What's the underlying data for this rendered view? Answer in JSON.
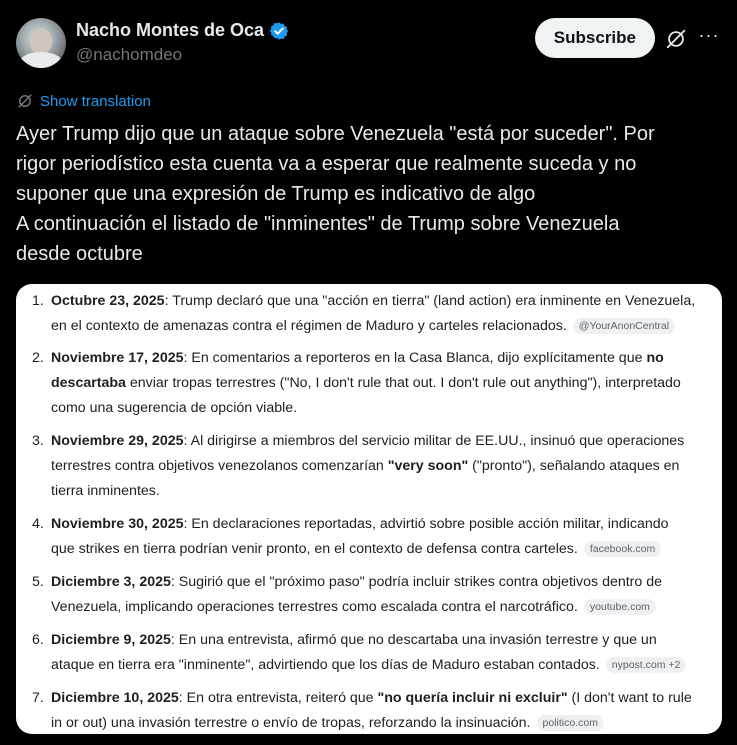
{
  "header": {
    "display_name": "Nacho Montes de Oca",
    "handle": "@nachomdeo",
    "subscribe_label": "Subscribe",
    "more_label": "···"
  },
  "translate": {
    "label": "Show translation"
  },
  "tweet": {
    "lines": [
      "Ayer Trump dijo que un ataque sobre Venezuela \"está por suceder\". Por",
      "rigor periodístico esta cuenta va a esperar que realmente suceda y no",
      "suponer que una expresión de Trump es indicativo de algo",
      "A continuación el listado de \"inminentes\" de Trump sobre Venezuela",
      "desde octubre"
    ]
  },
  "list": [
    {
      "num": "1.",
      "date": "Octubre 23, 2025",
      "text_a": ": Trump declaró que una \"acción en tierra\" (land action) era inminente en Venezuela,",
      "text_b": "en el contexto de amenazas contra el régimen de Maduro y carteles relacionados.",
      "source": "@YourAnonCentral"
    },
    {
      "num": "2.",
      "date": "Noviembre 17, 2025",
      "text_a": ": En comentarios a reporteros en la Casa Blanca, dijo explícitamente que ",
      "bold_1": "no",
      "bold_2": "descartaba",
      "text_b": " enviar tropas terrestres (\"No, I don't rule that out. I don't rule out anything\"), interpretado",
      "text_c": "como una sugerencia de opción viable."
    },
    {
      "num": "3.",
      "date": "Noviembre 29, 2025",
      "text_a": ": Al dirigirse a miembros del servicio militar de EE.UU., insinuó que operaciones",
      "text_b": "terrestres contra objetivos venezolanos comenzarían ",
      "bold_1": "\"very soon\"",
      "text_c": " (\"pronto\"), señalando ataques en",
      "text_d": "tierra inminentes."
    },
    {
      "num": "4.",
      "date": "Noviembre 30, 2025",
      "text_a": ": En declaraciones reportadas, advirtió sobre posible acción militar, indicando",
      "text_b": "que strikes en tierra podrían venir pronto, en el contexto de defensa contra carteles.",
      "source": "facebook.com"
    },
    {
      "num": "5.",
      "date": "Diciembre 3, 2025",
      "text_a": ": Sugirió que el \"próximo paso\" podría incluir strikes contra objetivos dentro de",
      "text_b": "Venezuela, implicando operaciones terrestres como escalada contra el narcotráfico.",
      "source": "youtube.com"
    },
    {
      "num": "6.",
      "date": "Diciembre 9, 2025",
      "text_a": ": En una entrevista, afirmó que no descartaba una invasión terrestre y que un",
      "text_b": "ataque en tierra era \"inminente\", advirtiendo que los días de Maduro estaban contados.",
      "source": "nypost.com +2"
    },
    {
      "num": "7.",
      "date": "Diciembre 10, 2025",
      "text_a": ": En otra entrevista, reiteró que ",
      "bold_1": "\"no quería incluir ni excluir\"",
      "text_b": " (I don't want to rule",
      "text_c": "in or out) una invasión terrestre o envío de tropas, reforzando la insinuación.",
      "source": "politico.com"
    }
  ]
}
